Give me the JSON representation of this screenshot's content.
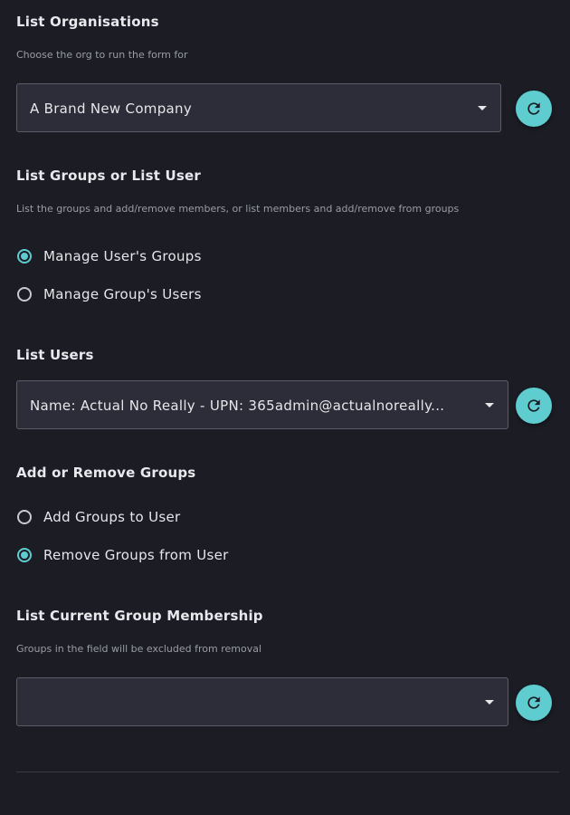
{
  "orgs": {
    "title": "List Organisations",
    "description": "Choose the org to run the form for",
    "selected": "A Brand New Company"
  },
  "groups_or_user": {
    "title": "List Groups or List User",
    "description": "List the groups and add/remove members, or list members and add/remove from groups",
    "options": [
      {
        "label": "Manage User's Groups",
        "checked": true
      },
      {
        "label": "Manage Group's Users",
        "checked": false
      }
    ]
  },
  "users": {
    "title": "List Users",
    "selected": "Name: Actual No Really - UPN: 365admin@actualnoreally..."
  },
  "add_remove": {
    "title": "Add or Remove Groups",
    "options": [
      {
        "label": "Add Groups to User",
        "checked": false
      },
      {
        "label": "Remove Groups from User",
        "checked": true
      }
    ]
  },
  "membership": {
    "title": "List Current Group Membership",
    "description": "Groups in the field will be excluded from removal",
    "selected": ""
  },
  "colors": {
    "background": "#1b1c24",
    "accent": "#5fcdd0",
    "field": "#2c2d38"
  },
  "icons": {
    "refresh": "refresh-icon",
    "dropdown": "chevron-down-icon"
  }
}
